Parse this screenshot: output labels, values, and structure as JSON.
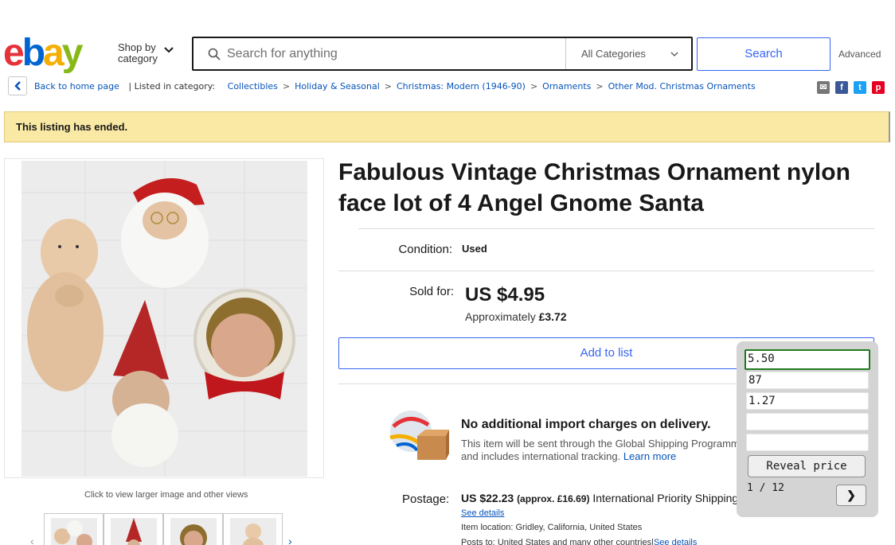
{
  "header": {
    "logo_text": "ebay",
    "shop_by_line1": "Shop by",
    "shop_by_line2": "category",
    "search_placeholder": "Search for anything",
    "category_select": "All Categories",
    "search_button": "Search",
    "advanced_link": "Advanced"
  },
  "breadcrumb": {
    "back": "Back to home page",
    "listed_in": "| Listed in category:",
    "items": [
      "Collectibles",
      "Holiday & Seasonal",
      "Christmas: Modern (1946-90)",
      "Ornaments",
      "Other Mod. Christmas Ornaments"
    ],
    "separator": ">"
  },
  "share_icons": [
    "email-icon",
    "facebook-icon",
    "twitter-icon",
    "pinterest-icon"
  ],
  "banner": {
    "message": "This listing has ended."
  },
  "gallery": {
    "caption": "Click to view larger image and other views",
    "thumb_count": 4
  },
  "listing": {
    "title": "Fabulous Vintage Christmas Ornament nylon face lot of 4 Angel Gnome Santa",
    "condition_label": "Condition:",
    "condition_value": "Used",
    "sold_label": "Sold for:",
    "price": "US $4.95",
    "approx_prefix": "Approximately",
    "approx_value": "£3.72",
    "add_to_list": "Add to list"
  },
  "shipping": {
    "no_import_title": "No additional import charges on delivery.",
    "description": "This item will be sent through the Global Shipping Programme and includes international tracking.",
    "learn_more": "Learn more",
    "postage_label": "Postage:",
    "postage_value": "US $22.23",
    "postage_approx": "(approx. £16.69)",
    "postage_method": "International Priority Shipping",
    "see_details": "See details",
    "item_location_label": "Item location:",
    "item_location": "Gridley, California, United States",
    "posts_to_label": "Posts to:",
    "posts_to": "United States and many other countries",
    "posts_to_link": "See details"
  },
  "panel": {
    "fields": [
      "5.50",
      "87",
      "1.27",
      "",
      ""
    ],
    "reveal_button": "Reveal price",
    "pager": "1 / 12",
    "next": "❯"
  },
  "colors": {
    "link": "#0654ba",
    "accent_blue": "#3665f3",
    "banner_bg": "#fae9a4",
    "ebay_red": "#e53238",
    "ebay_blue": "#0064d2",
    "ebay_yellow": "#f5af02",
    "ebay_green": "#86b817"
  }
}
